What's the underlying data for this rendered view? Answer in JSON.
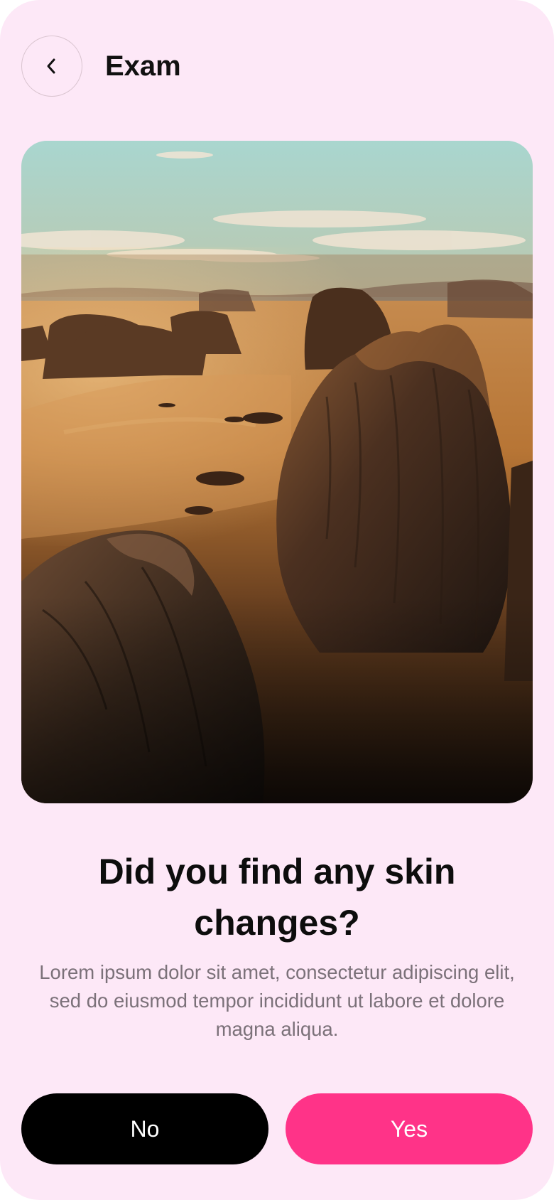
{
  "header": {
    "back_icon": "chevron-left-icon",
    "title": "Exam"
  },
  "hero_image": {
    "subject": "desert rock formations at sunset"
  },
  "question": {
    "heading": "Did you find any skin changes?",
    "description": "Lorem ipsum dolor sit amet, consectetur adipiscing elit, sed do eiusmod tempor incididunt ut labore et dolore magna aliqua."
  },
  "actions": {
    "no_label": "No",
    "yes_label": "Yes"
  },
  "colors": {
    "background": "#fde8f7",
    "primary_accent": "#ff3388",
    "secondary_button": "#000000",
    "heading_text": "#0d0d0d",
    "body_text": "#7b7179"
  }
}
